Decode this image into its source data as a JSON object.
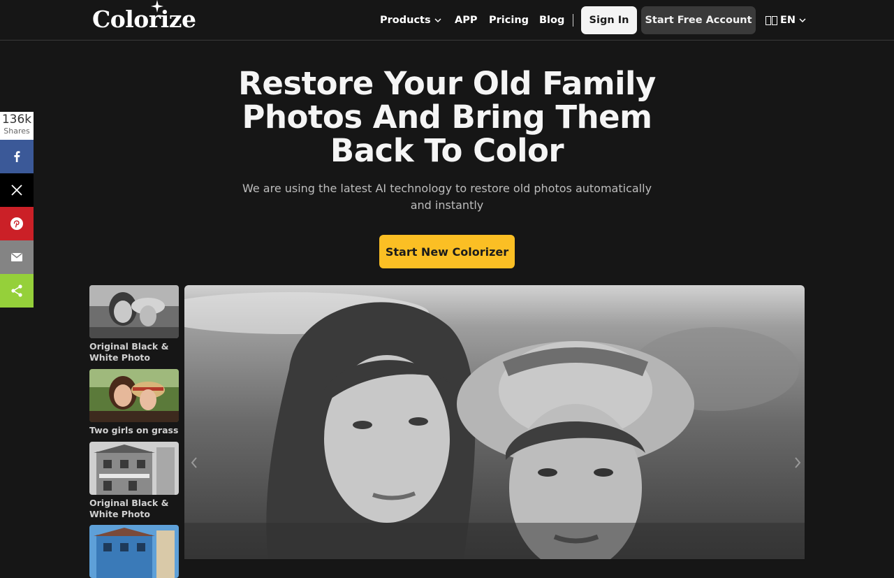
{
  "header": {
    "logo": "Colorize",
    "nav": {
      "products": "Products",
      "app": "APP",
      "pricing": "Pricing",
      "blog": "Blog"
    },
    "sign_in": "Sign In",
    "start_free": "Start Free Account",
    "language": "EN"
  },
  "hero": {
    "title": "Restore Your Old Family Photos And Bring Them Back To Color",
    "subtitle": "We are using the latest AI technology to restore old photos automatically and instantly",
    "cta": "Start New Colorizer"
  },
  "share": {
    "count": "136k",
    "label": "Shares",
    "buttons": [
      {
        "icon": "facebook-icon",
        "color": "#3b5998"
      },
      {
        "icon": "x-icon",
        "color": "#000000"
      },
      {
        "icon": "pinterest-icon",
        "color": "#cb2027"
      },
      {
        "icon": "email-icon",
        "color": "#848484"
      },
      {
        "icon": "share-icon",
        "color": "#95d03a"
      }
    ]
  },
  "gallery": {
    "thumbnails": [
      {
        "caption": "Original Black & White Photo"
      },
      {
        "caption": "Two girls on grass"
      },
      {
        "caption": "Original Black & White Photo"
      },
      {
        "caption": ""
      }
    ]
  },
  "colors": {
    "accent": "#fbbf24",
    "background": "#161616"
  }
}
